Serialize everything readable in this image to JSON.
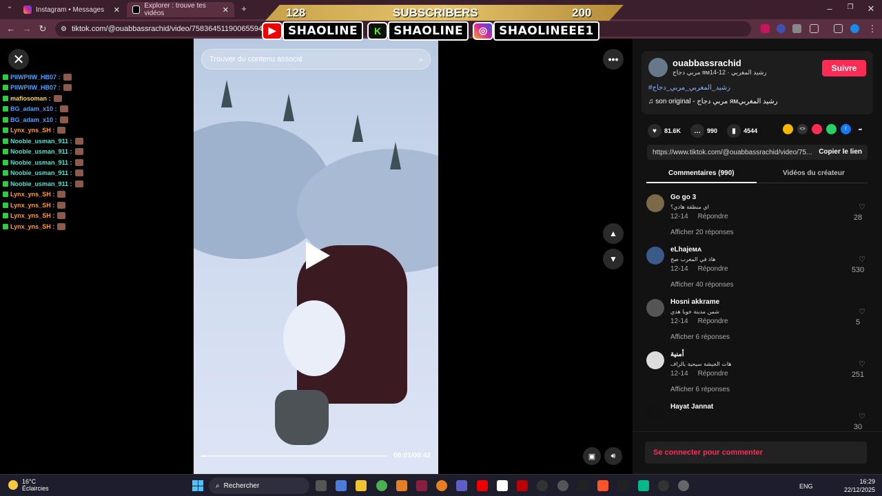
{
  "browser": {
    "tabs": [
      {
        "title": "Instagram • Messages"
      },
      {
        "title": "Explorer : trouve tes vidéos"
      }
    ],
    "url": "tiktok.com/@ouabbassrachid/video/7583645119006559491"
  },
  "overlay": {
    "subscribers_left": "128",
    "subscribers_label": "SUBSCRIBERS",
    "subscribers_right": "200",
    "socials": [
      "SHAOLINE",
      "SHAOLINE",
      "SHAOLINEEE1"
    ]
  },
  "chat": [
    {
      "user": "PlIWPIIW_HB07 :",
      "color": "#4aa3ff"
    },
    {
      "user": "PlIWPIIW_HB07 :",
      "color": "#4aa3ff"
    },
    {
      "user": "mafiosoman :",
      "color": "#ffd84a"
    },
    {
      "user": "BG_adam_x10 :",
      "color": "#4aa3ff"
    },
    {
      "user": "BG_adam_x10 :",
      "color": "#4aa3ff"
    },
    {
      "user": "Lynx_yns_SH :",
      "color": "#ff9f2e"
    },
    {
      "user": "Noobie_usman_911 :",
      "color": "#4fe0d0"
    },
    {
      "user": "Noobie_usman_911 :",
      "color": "#4fe0d0"
    },
    {
      "user": "Noobie_usman_911 :",
      "color": "#4fe0d0"
    },
    {
      "user": "Noobie_usman_911 :",
      "color": "#4fe0d0"
    },
    {
      "user": "Noobie_usman_911 :",
      "color": "#4fe0d0"
    },
    {
      "user": "Lynx_yns_SH :",
      "color": "#ff9f2e"
    },
    {
      "user": "Lynx_yns_SH :",
      "color": "#ff9f2e"
    },
    {
      "user": "Lynx_yns_SH :",
      "color": "#ff9f2e"
    },
    {
      "user": "Lynx_yns_SH :",
      "color": "#ff9f2e"
    }
  ],
  "video": {
    "search_placeholder": "Trouver du contenu associé",
    "time": "00:01/00:42",
    "progress": 0.03
  },
  "author": {
    "name": "ouabbassrachid",
    "subtitle": "مربي دجاج ᴙᴍرشيد المغربي · 12-14",
    "follow": "Suivre",
    "hashtag": "#رشيد_المغربي_مربي_دجاج",
    "music": "son original - مربي دجاج ᴙᴍرشيد المغربي"
  },
  "stats": {
    "likes": "81.6K",
    "comments": "990",
    "saves": "4544"
  },
  "link": {
    "url": "https://www.tiktok.com/@ouabbassrachid/video/75...",
    "copy": "Copier le lien"
  },
  "tabs": {
    "comments": "Commentaires (990)",
    "creator": "Vidéos du créateur"
  },
  "comments": [
    {
      "name": "Go go 3",
      "text": "اي منطقة هادي؟",
      "date": "12-14",
      "reply": "Répondre",
      "more": "Afficher 20 réponses",
      "likes": "28",
      "avatar": "#7a6a4a"
    },
    {
      "name": "eLhajeᴍᴀ",
      "text": "هاذ في المغرب صح",
      "date": "12-14",
      "reply": "Répondre",
      "more": "Afficher 40 réponses",
      "likes": "530",
      "avatar": "#3a5a8a"
    },
    {
      "name": "Hosni akkrame",
      "text": "شمن مدينة خويا هدي",
      "date": "12-14",
      "reply": "Répondre",
      "more": "Afficher 6 réponses",
      "likes": "5",
      "avatar": "#555"
    },
    {
      "name": "أمنية",
      "text": "هات الجيشة سيحية بالراف",
      "date": "12-14",
      "reply": "Répondre",
      "more": "Afficher 6 réponses",
      "likes": "251",
      "avatar": "#ddd"
    },
    {
      "name": "Hayat Jannat",
      "text": "",
      "date": "",
      "reply": "",
      "more": "",
      "likes": "30",
      "avatar": "#111"
    }
  ],
  "login_prompt": "Se connecter pour commenter",
  "taskbar": {
    "temp": "16°C",
    "weather": "Éclaircies",
    "search": "Rechercher",
    "lang": "ENG",
    "time": "16:29",
    "date": "22/12/2025"
  }
}
